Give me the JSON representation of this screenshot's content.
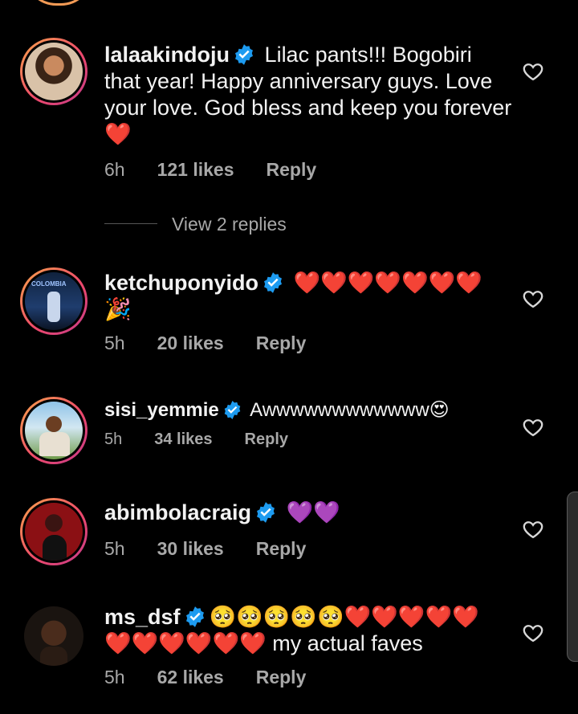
{
  "comments": [
    {
      "username": "lalaakindoju",
      "text": " Lilac pants!!! Bogobiri that year! Happy anniversary guys. Love your love. God bless and keep you forever ",
      "emoji_tail": "❤️",
      "time": "6h",
      "likes": "121 likes",
      "reply": "Reply",
      "view_replies": "View 2 replies"
    },
    {
      "username": "ketchuponyido",
      "text": " ❤️❤️❤️❤️❤️❤️❤️ 🎉",
      "time": "5h",
      "likes": "20 likes",
      "reply": "Reply",
      "avatar_caption": "COLOMBIA"
    },
    {
      "username": "sisi_yemmie",
      "text": " Awwwwwwwwwwww😍",
      "time": "5h",
      "likes": "34 likes",
      "reply": "Reply"
    },
    {
      "username": "abimbolacraig",
      "text": " 💜💜",
      "time": "5h",
      "likes": "30 likes",
      "reply": "Reply"
    },
    {
      "username": "ms_dsf",
      "emoji_row": "🥺🥺🥺🥺🥺❤️❤️❤️❤️❤️",
      "emoji_row2": "❤️❤️❤️❤️❤️❤️",
      "text_tail": " my actual faves",
      "time": "5h",
      "likes": "62 likes",
      "reply": "Reply"
    }
  ],
  "icons": {
    "verified": "verified-badge-icon",
    "like": "heart-outline-icon"
  },
  "colors": {
    "verified_blue": "#1d9bf0",
    "meta_gray": "#a8a8a8",
    "story_ring_start": "#f9a64a",
    "story_ring_end": "#c53a8a"
  }
}
